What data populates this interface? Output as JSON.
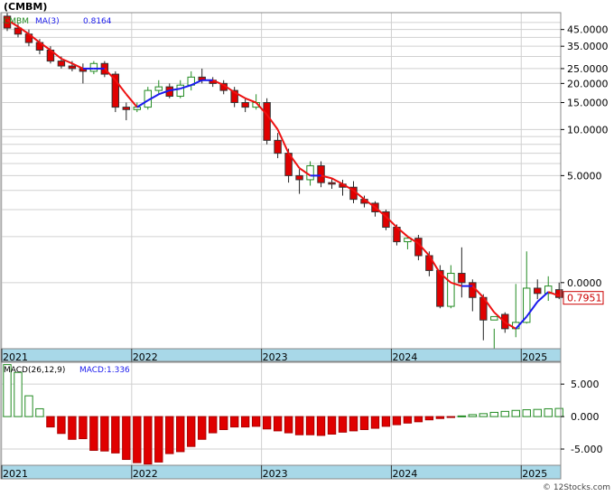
{
  "header": {
    "symbol": "(CMBM)"
  },
  "watermark": "© 12Stocks.com",
  "colors": {
    "up": "#228b22",
    "down": "#e00000",
    "ma_down": "#ee1111",
    "ma_up": "#1a1aee",
    "axis_band": "#a8d8e8",
    "grid": "#d0d0d0",
    "price_badge": "#cc0000"
  },
  "chart_data": [
    {
      "type": "candlestick",
      "legend": {
        "ticker": "CMBM",
        "ma_label": "MA(3)",
        "ma_value": "0.8164"
      },
      "y_scale": "log",
      "y_tick_labels": [
        "45.0000",
        "35.0000",
        "25.0000",
        "20.0000",
        "15.0000",
        "10.0000",
        "5.0000",
        "0.0000"
      ],
      "y_tick_values": [
        45,
        35,
        25,
        20,
        15,
        10,
        5,
        1
      ],
      "last_price_label": "0.7951",
      "x_tick_labels": [
        "2021",
        "2022",
        "2023",
        "2024",
        "2025"
      ],
      "x_tick_index": [
        0,
        12,
        24,
        36,
        48
      ],
      "grid": true,
      "candles": [
        {
          "o": 55,
          "h": 58,
          "l": 44,
          "c": 46
        },
        {
          "o": 46,
          "h": 49,
          "l": 40,
          "c": 42
        },
        {
          "o": 42,
          "h": 45,
          "l": 35,
          "c": 37
        },
        {
          "o": 37,
          "h": 39,
          "l": 31,
          "c": 33
        },
        {
          "o": 33,
          "h": 35,
          "l": 27,
          "c": 28
        },
        {
          "o": 28,
          "h": 30,
          "l": 25,
          "c": 26
        },
        {
          "o": 26,
          "h": 28,
          "l": 24,
          "c": 25
        },
        {
          "o": 25,
          "h": 27,
          "l": 20,
          "c": 24
        },
        {
          "o": 24,
          "h": 28,
          "l": 23,
          "c": 27
        },
        {
          "o": 27,
          "h": 28,
          "l": 22,
          "c": 23
        },
        {
          "o": 23,
          "h": 24,
          "l": 13,
          "c": 14
        },
        {
          "o": 14,
          "h": 15,
          "l": 11.5,
          "c": 13.5
        },
        {
          "o": 13.5,
          "h": 15,
          "l": 13,
          "c": 14
        },
        {
          "o": 14,
          "h": 19,
          "l": 13.5,
          "c": 18
        },
        {
          "o": 18,
          "h": 21,
          "l": 17,
          "c": 19
        },
        {
          "o": 19,
          "h": 20,
          "l": 16,
          "c": 16.5
        },
        {
          "o": 16.5,
          "h": 21,
          "l": 16,
          "c": 19.5
        },
        {
          "o": 19.5,
          "h": 24,
          "l": 18,
          "c": 22
        },
        {
          "o": 22,
          "h": 25,
          "l": 20,
          "c": 21
        },
        {
          "o": 21,
          "h": 22,
          "l": 19,
          "c": 20
        },
        {
          "o": 20,
          "h": 21,
          "l": 17,
          "c": 18
        },
        {
          "o": 18,
          "h": 19,
          "l": 14,
          "c": 15
        },
        {
          "o": 15,
          "h": 16,
          "l": 13,
          "c": 14
        },
        {
          "o": 14,
          "h": 17,
          "l": 13.5,
          "c": 15
        },
        {
          "o": 15,
          "h": 16,
          "l": 8,
          "c": 8.5
        },
        {
          "o": 8.5,
          "h": 9.5,
          "l": 6.5,
          "c": 7
        },
        {
          "o": 7,
          "h": 7.5,
          "l": 4.5,
          "c": 5
        },
        {
          "o": 5,
          "h": 5.5,
          "l": 3.8,
          "c": 4.7
        },
        {
          "o": 4.7,
          "h": 6.2,
          "l": 4.3,
          "c": 5.8
        },
        {
          "o": 5.8,
          "h": 6.2,
          "l": 4.2,
          "c": 4.5
        },
        {
          "o": 4.5,
          "h": 4.8,
          "l": 4.1,
          "c": 4.4
        },
        {
          "o": 4.4,
          "h": 4.7,
          "l": 3.7,
          "c": 4.2
        },
        {
          "o": 4.2,
          "h": 4.6,
          "l": 3.3,
          "c": 3.5
        },
        {
          "o": 3.5,
          "h": 3.7,
          "l": 3.1,
          "c": 3.3
        },
        {
          "o": 3.3,
          "h": 3.4,
          "l": 2.7,
          "c": 2.9
        },
        {
          "o": 2.9,
          "h": 3.0,
          "l": 2.2,
          "c": 2.3
        },
        {
          "o": 2.3,
          "h": 2.4,
          "l": 1.75,
          "c": 1.85
        },
        {
          "o": 1.85,
          "h": 2.0,
          "l": 1.65,
          "c": 1.95
        },
        {
          "o": 1.95,
          "h": 2.05,
          "l": 1.4,
          "c": 1.5
        },
        {
          "o": 1.5,
          "h": 1.6,
          "l": 1.1,
          "c": 1.2
        },
        {
          "o": 1.2,
          "h": 1.3,
          "l": 0.68,
          "c": 0.7
        },
        {
          "o": 0.7,
          "h": 1.3,
          "l": 0.68,
          "c": 1.15
        },
        {
          "o": 1.15,
          "h": 1.7,
          "l": 0.8,
          "c": 1.0
        },
        {
          "o": 1.0,
          "h": 1.05,
          "l": 0.65,
          "c": 0.8
        },
        {
          "o": 0.8,
          "h": 0.84,
          "l": 0.42,
          "c": 0.57
        },
        {
          "o": 0.57,
          "h": 0.5,
          "l": 0.37,
          "c": 0.6
        },
        {
          "o": 0.62,
          "h": 0.64,
          "l": 0.47,
          "c": 0.5
        },
        {
          "o": 0.5,
          "h": 0.98,
          "l": 0.44,
          "c": 0.55
        },
        {
          "o": 0.55,
          "h": 1.6,
          "l": 0.54,
          "c": 0.92
        },
        {
          "o": 0.92,
          "h": 1.05,
          "l": 0.78,
          "c": 0.85
        },
        {
          "o": 0.85,
          "h": 1.1,
          "l": 0.76,
          "c": 0.95
        },
        {
          "o": 0.9,
          "h": 1.0,
          "l": 0.78,
          "c": 0.8
        }
      ],
      "ma": [
        52,
        47,
        42,
        37,
        33,
        29,
        27,
        25,
        25,
        25,
        21,
        17,
        14,
        15.5,
        17,
        18,
        18.5,
        19.5,
        21,
        21,
        19.5,
        17.5,
        16,
        15,
        12.5,
        10,
        7,
        5.6,
        5,
        5,
        4.8,
        4.4,
        4.0,
        3.5,
        3.1,
        2.7,
        2.3,
        2.0,
        1.8,
        1.5,
        1.15,
        1.0,
        0.95,
        0.95,
        0.8,
        0.64,
        0.55,
        0.5,
        0.6,
        0.75,
        0.87,
        0.82
      ]
    },
    {
      "type": "bar",
      "legend": {
        "label": "MACD(26,12,9)",
        "value_label": "MACD:1.336"
      },
      "y_tick_labels": [
        "5.000",
        "0.000",
        "-5.000"
      ],
      "y_tick_values": [
        5,
        0,
        -5
      ],
      "ylim": [
        -7.5,
        8.5
      ],
      "x_tick_labels": [
        "2021",
        "2022",
        "2023",
        "2024",
        "2025"
      ],
      "x_tick_index": [
        0,
        12,
        24,
        36,
        48
      ],
      "values": [
        8,
        6.8,
        3.2,
        1.2,
        -1.6,
        -2.6,
        -3.5,
        -3.4,
        -5.2,
        -5.3,
        -5.6,
        -6.6,
        -7.1,
        -7.3,
        -7.0,
        -5.7,
        -5.4,
        -4.6,
        -3.5,
        -2.5,
        -2.0,
        -1.6,
        -1.6,
        -1.5,
        -1.9,
        -2.2,
        -2.5,
        -2.8,
        -2.8,
        -2.9,
        -2.7,
        -2.4,
        -2.2,
        -2.0,
        -1.8,
        -1.5,
        -1.25,
        -1.0,
        -0.8,
        -0.5,
        -0.3,
        -0.1,
        0.1,
        0.3,
        0.45,
        0.65,
        0.8,
        0.95,
        1.05,
        1.1,
        1.2,
        1.25
      ]
    }
  ]
}
